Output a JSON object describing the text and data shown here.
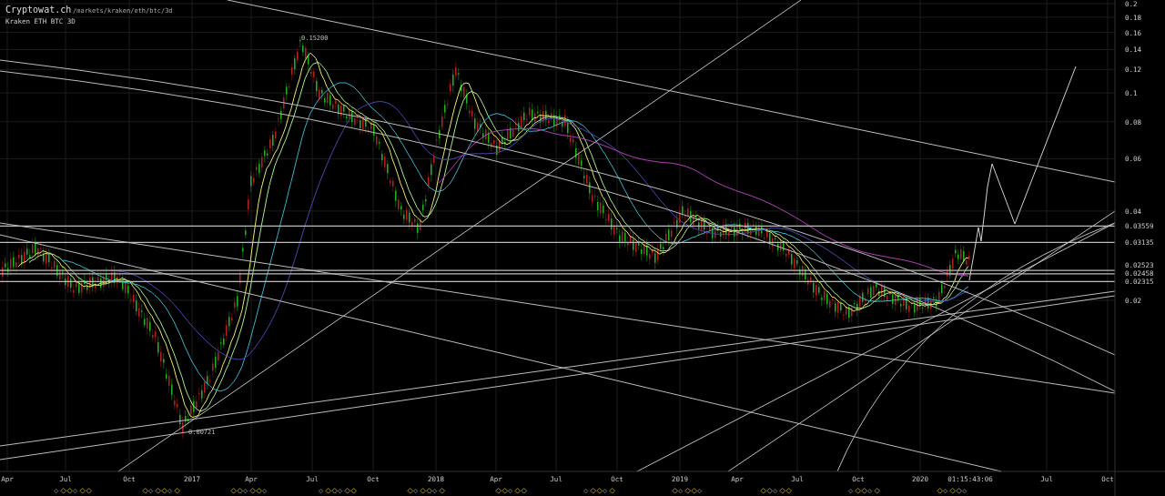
{
  "header": {
    "site": "Cryptowat.ch",
    "path": "/markets/kraken/eth/btc/3d",
    "market": "Kraken ETH BTC 3D"
  },
  "price_axis": {
    "labels": [
      "0.2",
      "0.18",
      "0.16",
      "0.14",
      "0.12",
      "0.1",
      "0.08",
      "0.06",
      "0.04",
      "0.02"
    ]
  },
  "levels": [
    {
      "label": "0.03559"
    },
    {
      "label": "0.03135"
    },
    {
      "label": "0.02523"
    },
    {
      "label": "0.02458"
    },
    {
      "label": "0.02315"
    }
  ],
  "annotations": [
    {
      "label": "0.15200"
    },
    {
      "label": "0.00721"
    }
  ],
  "time_axis": {
    "labels": [
      "Apr",
      "Jul",
      "Oct",
      "2017",
      "Apr",
      "Jul",
      "Oct",
      "2018",
      "Apr",
      "Jul",
      "Oct",
      "2019",
      "Apr",
      "Jul",
      "Oct",
      "2020",
      "Jul",
      "Oct"
    ],
    "countdown": "01:15:43:06"
  }
}
